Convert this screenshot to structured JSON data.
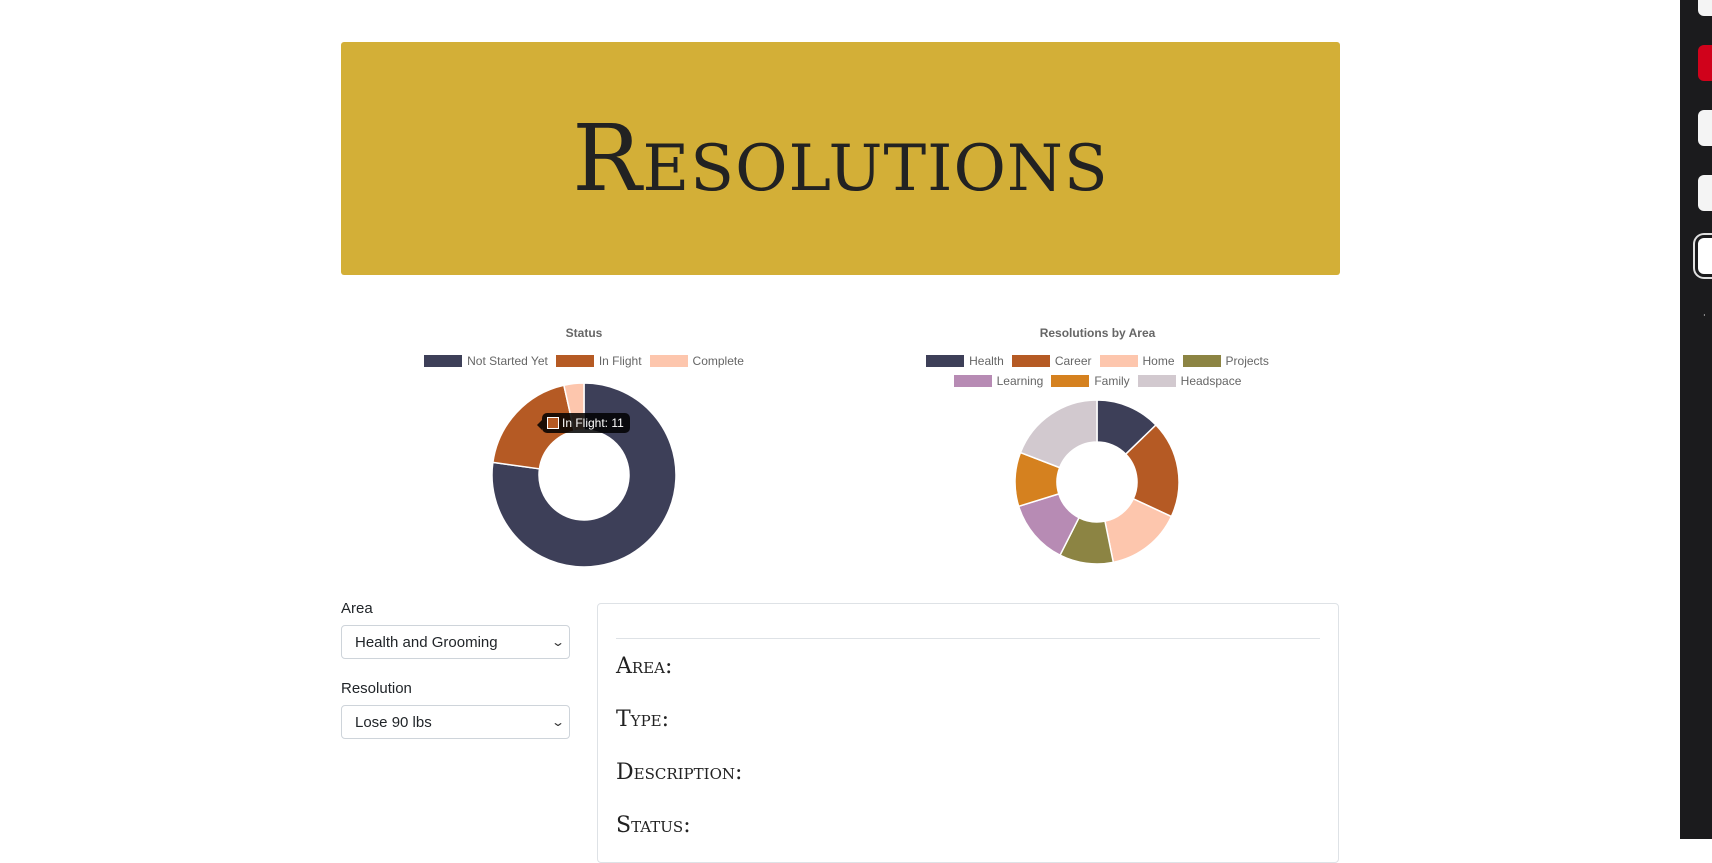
{
  "header": {
    "title": "Resolutions"
  },
  "status_chart": {
    "title": "Status",
    "legend": [
      {
        "label": "Not Started Yet",
        "color": "#3d3f58"
      },
      {
        "label": "In Flight",
        "color": "#b55a24"
      },
      {
        "label": "Complete",
        "color": "#fdc6ad"
      }
    ],
    "tooltip": "In Flight: 11"
  },
  "area_chart": {
    "title": "Resolutions by Area",
    "legend": [
      {
        "label": "Health",
        "color": "#3d3f58"
      },
      {
        "label": "Career",
        "color": "#b55a24"
      },
      {
        "label": "Home",
        "color": "#fdc6ad"
      },
      {
        "label": "Projects",
        "color": "#8c8443"
      },
      {
        "label": "Learning",
        "color": "#b78bb4"
      },
      {
        "label": "Family",
        "color": "#d5811f"
      },
      {
        "label": "Headspace",
        "color": "#d2c9cf"
      }
    ]
  },
  "chart_data": [
    {
      "type": "pie",
      "title": "Status",
      "labels": [
        "Not Started Yet",
        "In Flight",
        "Complete"
      ],
      "values": [
        44,
        11,
        2
      ]
    },
    {
      "type": "pie",
      "title": "Resolutions by Area",
      "labels": [
        "Health",
        "Career",
        "Home",
        "Projects",
        "Learning",
        "Family",
        "Headspace"
      ],
      "values": [
        6,
        9,
        7,
        5,
        6,
        5,
        9
      ]
    }
  ],
  "form": {
    "area_label": "Area",
    "area_value": "Health and Grooming",
    "resolution_label": "Resolution",
    "resolution_value": "Lose 90 lbs"
  },
  "details": {
    "area_label": "Area:",
    "type_label": "Type:",
    "description_label": "Description:",
    "status_label": "Status:"
  }
}
